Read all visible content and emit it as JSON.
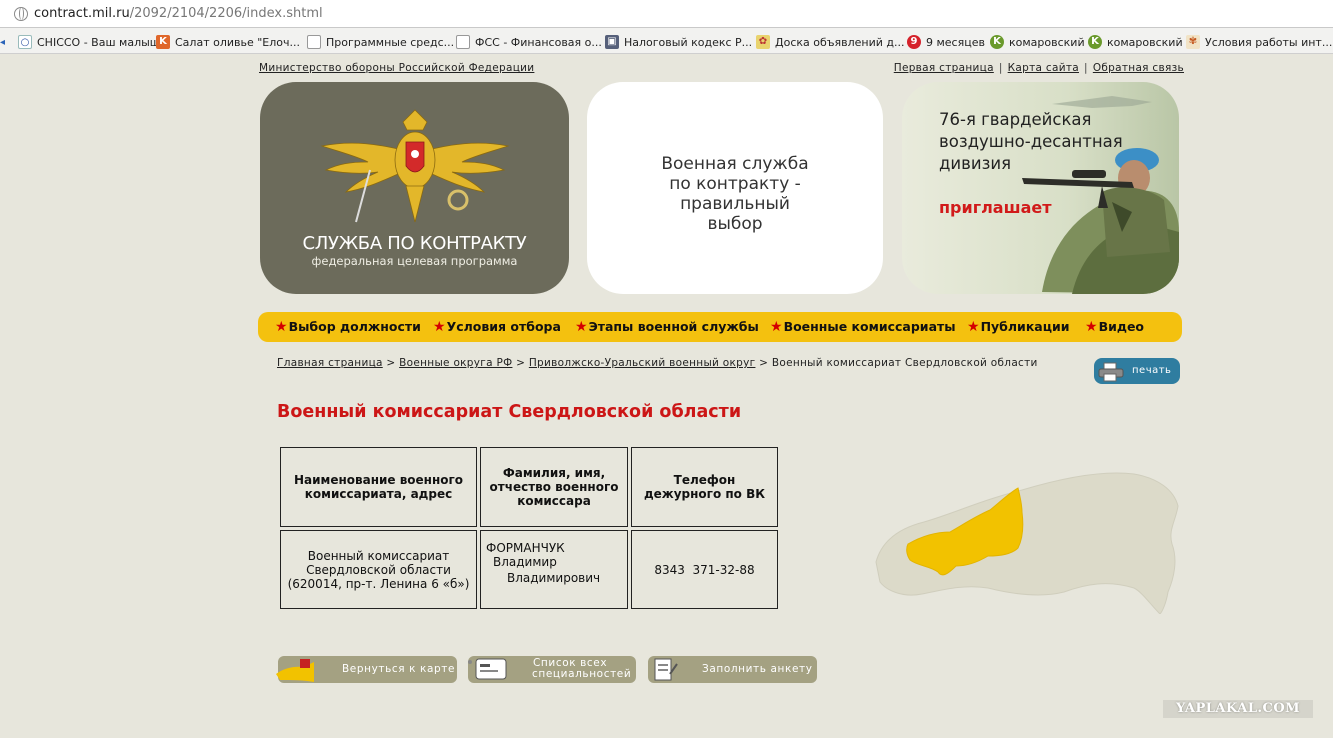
{
  "browser": {
    "url_host": "contract.mil.ru",
    "url_path": "/2092/2104/2206/index.shtml",
    "bookmarks": [
      {
        "label": "CHICCO - Ваш малыш",
        "icon": "chicco-icon"
      },
      {
        "label": "Салат оливье \"Елоч...",
        "icon": "k-icon"
      },
      {
        "label": "Программные средс...",
        "icon": "page-icon"
      },
      {
        "label": "ФСС - Финансовая о...",
        "icon": "page-icon"
      },
      {
        "label": "Налоговый кодекс Р...",
        "icon": "nalog-icon"
      },
      {
        "label": "Доска объявлений д...",
        "icon": "board-icon"
      },
      {
        "label": "9 месяцев",
        "icon": "nine-icon"
      },
      {
        "label": "комаровский",
        "icon": "komarovsky-icon"
      },
      {
        "label": "комаровский",
        "icon": "komarovsky-icon"
      },
      {
        "label": "Условия работы инт...",
        "icon": "flower-icon"
      }
    ]
  },
  "header": {
    "ministry_link": "Министерство обороны Российской Федерации",
    "links": [
      "Первая страница",
      "Карта сайта",
      "Обратная связь"
    ],
    "separator": "|"
  },
  "banners": {
    "program_title": "СЛУЖБА ПО КОНТРАКТУ",
    "program_subtitle": "федеральная целевая программа",
    "slogan_lines": [
      "Военная служба",
      "по контракту -",
      "правильный",
      "выбор"
    ],
    "division_lines": [
      "76-я гвардейская",
      "воздушно-десантная",
      "дивизия"
    ],
    "invites": "приглашает"
  },
  "nav": {
    "items": [
      "Выбор должности",
      "Условия отбора",
      "Этапы военной службы",
      "Военные комиссариаты",
      "Публикации",
      "Видео"
    ],
    "star": "★"
  },
  "breadcrumb": {
    "links": [
      "Главная страница",
      "Военные округа РФ",
      "Приволжско-Уральский военный округ"
    ],
    "current": "Военный комиссариат Свердловской области",
    "separator": ">"
  },
  "print_label": "печать",
  "page_title": "Военный комиссариат Свердловской области",
  "table": {
    "headers": [
      [
        "Наименование военного",
        "комиссариата, адрес"
      ],
      [
        "Фамилия, имя,",
        "отчество военного",
        "комиссара"
      ],
      [
        "Телефон",
        "дежурного по ВК"
      ]
    ],
    "rows": [
      {
        "address_lines": [
          "Военный комиссариат",
          "Свердловской области",
          "(620014, пр-т.  Ленина 6 «б»)"
        ],
        "name_lines": [
          "ФОРМАНЧУК",
          "Владимир",
          "Владимирович"
        ],
        "phone": "8343  371-32-88"
      }
    ]
  },
  "map": {
    "highlight_color": "#f2c200",
    "base_color": "#dcdac9"
  },
  "bottom_buttons": [
    {
      "lines": [
        "Вернуться к карте"
      ]
    },
    {
      "lines": [
        "Список всех",
        "специальностей"
      ]
    },
    {
      "lines": [
        "Заполнить анкету"
      ]
    }
  ],
  "watermark": "YAPLAKAL.COM",
  "colors": {
    "nav_bg": "#f4c10f",
    "title_red": "#cc1616",
    "page_bg": "#e7e6dc"
  }
}
